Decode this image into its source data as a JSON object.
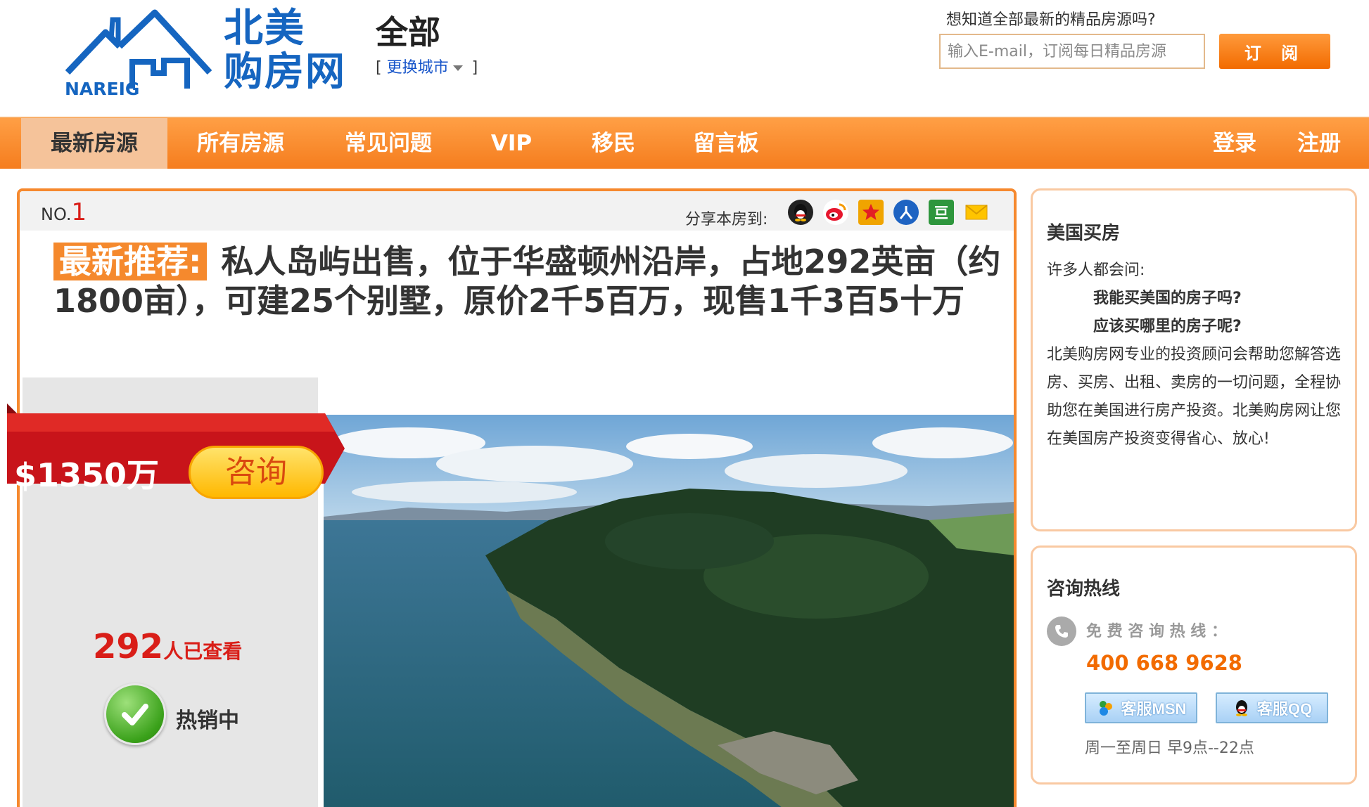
{
  "header": {
    "logo_text_line1": "北美",
    "logo_text_line2": "购房网",
    "logo_en": "NAREIG",
    "city": "全部",
    "city_switch_label": "更换城市",
    "bracket_open": "[",
    "bracket_close": "]",
    "subscribe_prompt": "想知道全部最新的精品房源吗?",
    "subscribe_placeholder": "输入E-mail，订阅每日精品房源",
    "subscribe_button": "订 阅"
  },
  "nav": {
    "items": [
      {
        "label": "最新房源",
        "active": true
      },
      {
        "label": "所有房源",
        "active": false
      },
      {
        "label": "常见问题",
        "active": false
      },
      {
        "label": "VIP",
        "active": false
      },
      {
        "label": "移民",
        "active": false
      },
      {
        "label": "留言板",
        "active": false
      }
    ],
    "login": "登录",
    "register": "注册"
  },
  "listing": {
    "no_prefix": "NO.",
    "no_number": "1",
    "share_label": "分享本房到:",
    "share_icons": [
      "qq-icon",
      "weibo-icon",
      "qzone-icon",
      "renren-icon",
      "douban-icon",
      "email-icon"
    ],
    "tag": "最新推荐:",
    "title": "私人岛屿出售，位于华盛顿州沿岸，占地292英亩（约1800亩），可建25个别墅，原价2千5百万，现售1千3百5十万",
    "price": "$1350万",
    "consult_button": "咨询",
    "views_count": "292",
    "views_suffix": "人已查看",
    "status": "热销中"
  },
  "sidebar": {
    "buy_box": {
      "title": "美国买房",
      "intro": "许多人都会问:",
      "q1": "我能买美国的房子吗?",
      "q2": "应该买哪里的房子呢?",
      "body": "北美购房网专业的投资顾问会帮助您解答选房、买房、出租、卖房的一切问题，全程协助您在美国进行房产投资。北美购房网让您在美国房产投资变得省心、放心!"
    },
    "hotline_box": {
      "title": "咨询热线",
      "free_label": "免 费 咨 询 热 线 ：",
      "phone": "400 668 9628",
      "msn_button": "客服MSN",
      "qq_button": "客服QQ",
      "hours": "周一至周日 早9点--22点"
    }
  },
  "colors": {
    "brand_orange": "#f57d1e",
    "brand_blue": "#1565c0",
    "price_red": "#d91e18",
    "phone_orange": "#f26b00"
  }
}
